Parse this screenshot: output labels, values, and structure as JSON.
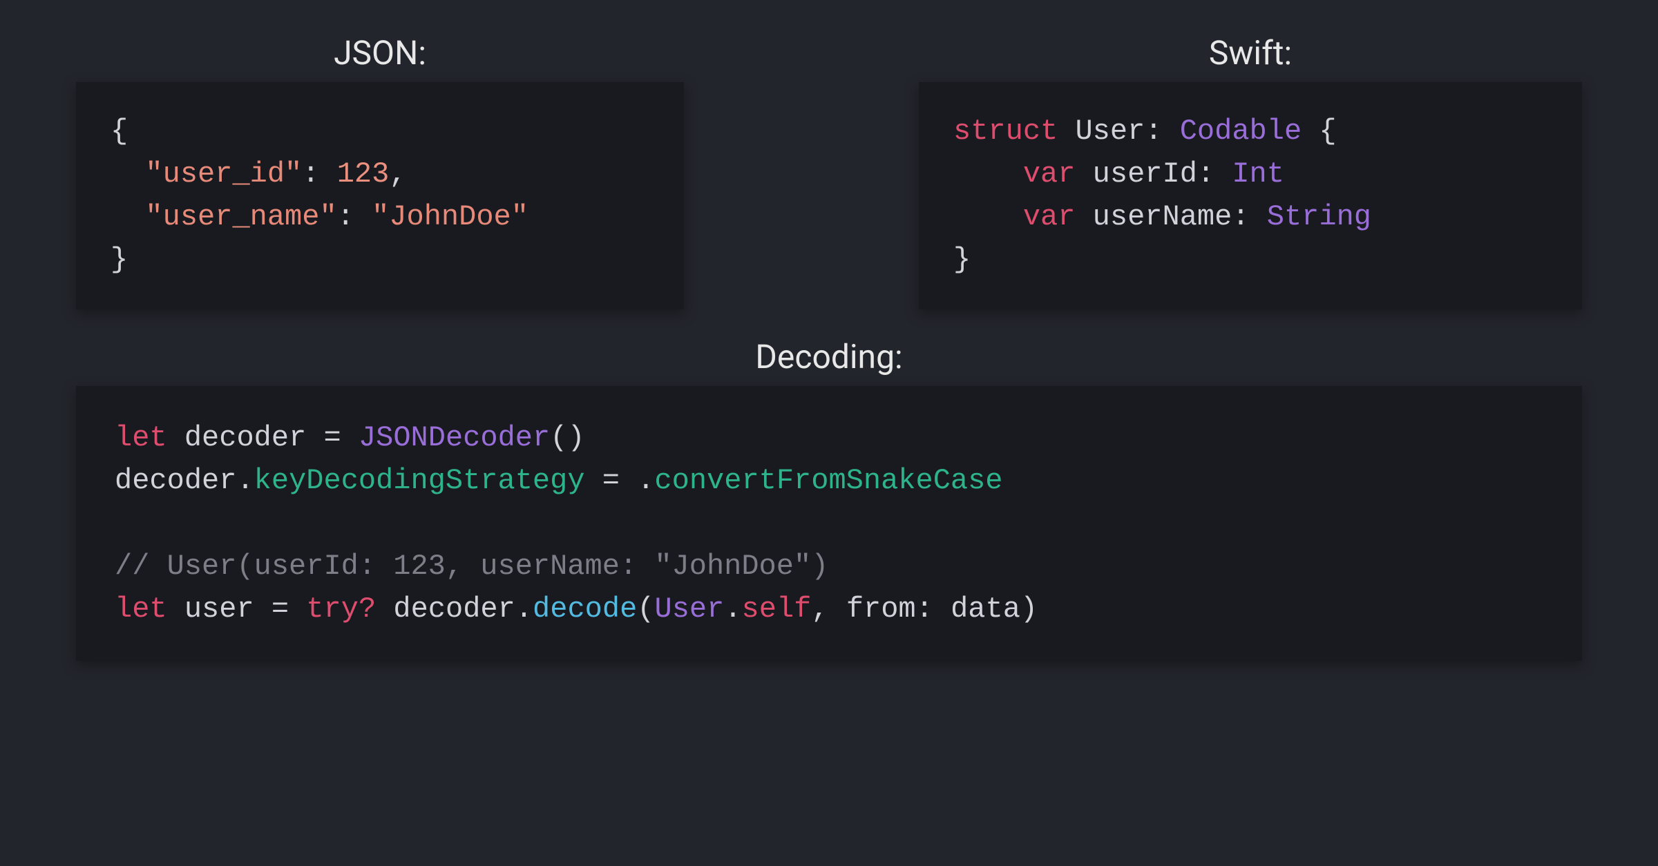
{
  "titles": {
    "json": "JSON:",
    "swift": "Swift:",
    "decoding": "Decoding:"
  },
  "jsonBlock": {
    "open": "{",
    "close": "}",
    "key_user_id": "\"user_id\"",
    "val_user_id": "123",
    "key_user_name": "\"user_name\"",
    "val_user_name": "\"JohnDoe\""
  },
  "swiftBlock": {
    "kw_struct": "struct",
    "name_user": "User",
    "colon": ":",
    "proto_codable": "Codable",
    "brace_open": "{",
    "brace_close": "}",
    "kw_var1": "var",
    "field_userId": "userId",
    "type_int": "Int",
    "kw_var2": "var",
    "field_userName": "userName",
    "type_string": "String"
  },
  "decodingBlock": {
    "kw_let1": "let",
    "id_decoder": "decoder",
    "eq": "=",
    "type_jsondecoder": "JSONDecoder",
    "parens": "()",
    "id_decoder2": "decoder",
    "dot1": ".",
    "prop_strategy": "keyDecodingStrategy",
    "eq2": "=",
    "dot2": ".",
    "case_convert": "convertFromSnakeCase",
    "comment": "// User(userId: 123, userName: \"JohnDoe\")",
    "kw_let2": "let",
    "id_user": "user",
    "eq3": "=",
    "kw_try": "try",
    "qmark": "?",
    "id_decoder3": "decoder",
    "dot3": ".",
    "fn_decode": "decode",
    "lparen": "(",
    "type_user": "User",
    "dot4": ".",
    "kw_self": "self",
    "comma": ",",
    "arg_from": "from",
    "colon2": ":",
    "id_data": "data",
    "rparen": ")"
  }
}
